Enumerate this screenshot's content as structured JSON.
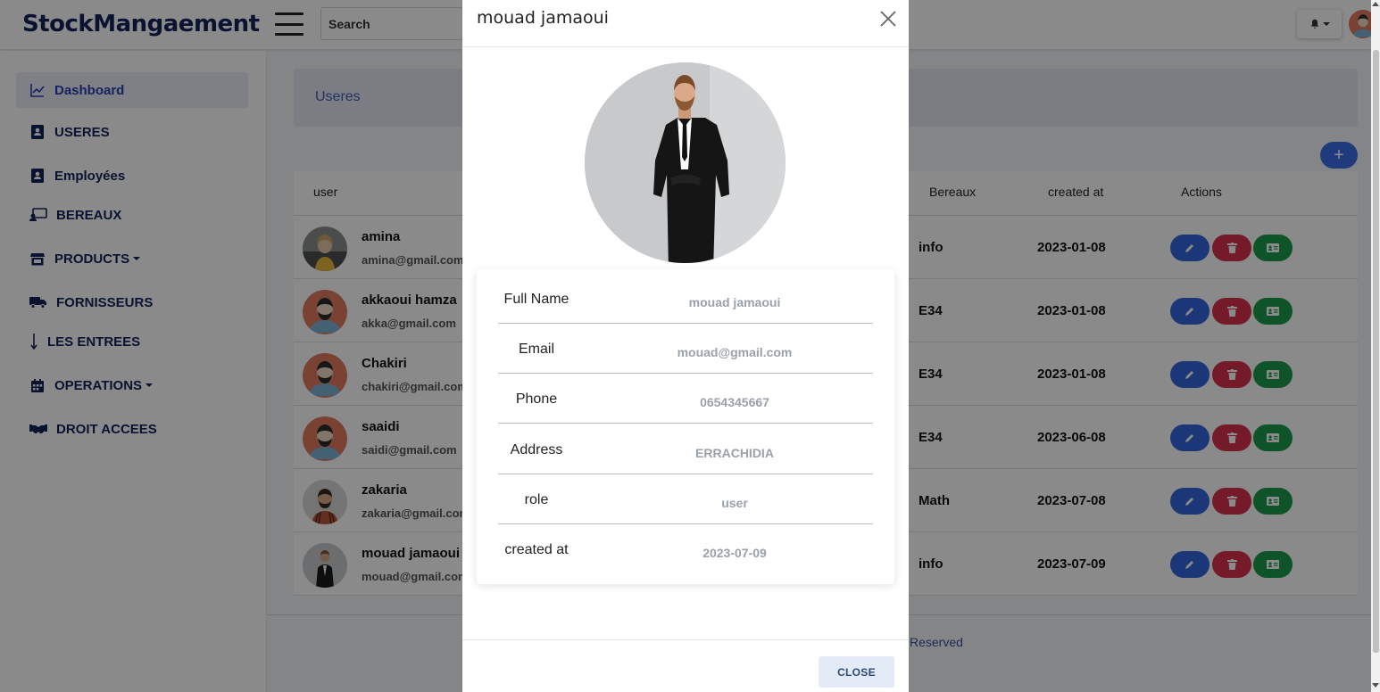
{
  "app": {
    "brand": "StockMangaement",
    "search_placeholder": "Search"
  },
  "sidebar": {
    "items": [
      {
        "label": "Dashboard",
        "icon": "chart-line-icon",
        "active": true
      },
      {
        "label": "USERES",
        "icon": "user-card-icon"
      },
      {
        "label": "Employées",
        "icon": "user-card-icon"
      },
      {
        "label": "BEREAUX",
        "icon": "office-icon"
      },
      {
        "label": "PRODUCTS",
        "icon": "store-icon",
        "dropdown": true
      },
      {
        "label": "FORNISSEURS",
        "icon": "truck-icon"
      },
      {
        "label": "LES ENTREES",
        "icon": "arrow-down-icon"
      },
      {
        "label": "OPERATIONS",
        "icon": "calendar-icon",
        "dropdown": true
      },
      {
        "label": "DROIT ACCEES",
        "icon": "handshake-icon"
      }
    ]
  },
  "main": {
    "hero_title": "Useres",
    "add_label": "+",
    "table": {
      "headers": {
        "user": "user",
        "bureau": "Bereaux",
        "created": "created at",
        "actions": "Actions"
      },
      "rows": [
        {
          "name": "amina",
          "email": "amina@gmail.com",
          "bureau": "info",
          "created": "2023-01-08"
        },
        {
          "name": "akkaoui hamza",
          "email": "akka@gmail.com",
          "bureau": "E34",
          "created": "2023-01-08"
        },
        {
          "name": "Chakiri",
          "email": "chakiri@gmail.com",
          "bureau": "E34",
          "created": "2023-01-08"
        },
        {
          "name": "saaidi",
          "email": "saidi@gmail.com",
          "bureau": "E34",
          "created": "2023-06-08"
        },
        {
          "name": "zakaria",
          "email": "zakaria@gmail.com",
          "bureau": "Math",
          "created": "2023-07-08"
        },
        {
          "name": "mouad jamaoui",
          "email": "mouad@gmail.com",
          "bureau": "info",
          "created": "2023-07-09"
        }
      ]
    },
    "footer_text": "Reserved"
  },
  "modal": {
    "title": "mouad jamaoui",
    "fields": [
      {
        "label": "Full Name",
        "value": "mouad jamaoui"
      },
      {
        "label": "Email",
        "value": "mouad@gmail.com"
      },
      {
        "label": "Phone",
        "value": "0654345667"
      },
      {
        "label": "Address",
        "value": "ERRACHIDIA"
      },
      {
        "label": "role",
        "value": "user"
      },
      {
        "label": "created at",
        "value": "2023-07-09"
      }
    ],
    "close_label": "CLOSE"
  },
  "colors": {
    "brand": "#12245a",
    "edit": "#3366dd",
    "delete": "#d9304a",
    "card": "#1d9b4a",
    "add": "#3a6ee8"
  }
}
